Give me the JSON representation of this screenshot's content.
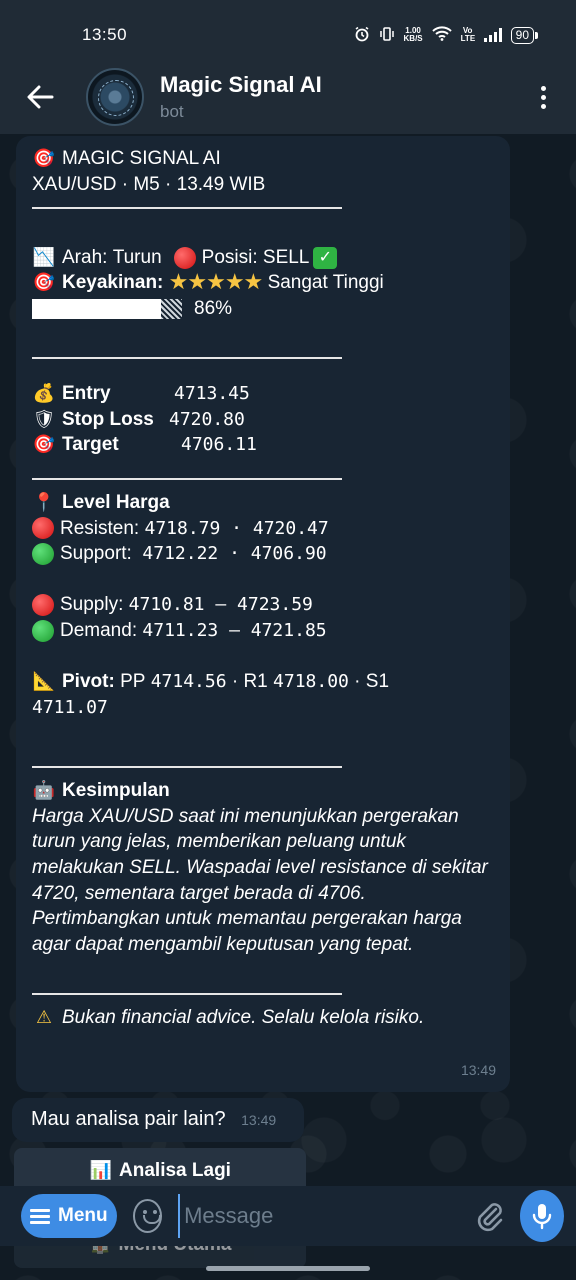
{
  "status_bar": {
    "time": "13:50",
    "speed_value": "1.00",
    "speed_unit": "KB/S",
    "volte": "Vo LTE",
    "battery": "90"
  },
  "app_bar": {
    "title": "Magic Signal AI",
    "subtitle": "bot"
  },
  "signal_message": {
    "header_title": "MAGIC SIGNAL AI",
    "header_info": "XAU/USD · M5 · 13.49 WIB",
    "direction_label": "Arah:",
    "direction_value": "Turun",
    "position_label": "Posisi:",
    "position_value": "SELL",
    "confidence_label": "Keyakinan:",
    "confidence_stars": "★★★★★",
    "confidence_text": "Sangat Tinggi",
    "confidence_percent_label": "86%",
    "confidence_percent": 86,
    "entry_label": "Entry",
    "entry_value": "4713.45",
    "stoploss_label": "Stop Loss",
    "stoploss_value": "4720.80",
    "target_label": "Target",
    "target_value": "4706.11",
    "level_title": "Level Harga",
    "resisten_label": "Resisten:",
    "resisten_values": "4718.79 · 4720.47",
    "support_label": "Support:",
    "support_values": "4712.22 · 4706.90",
    "supply_label": "Supply:",
    "supply_values": "4710.81 — 4723.59",
    "demand_label": "Demand:",
    "demand_values": "4711.23 — 4721.85",
    "pivot_label": "Pivot:",
    "pivot_pp_label": "PP",
    "pivot_pp": "4714.56",
    "pivot_r1_label": "R1",
    "pivot_r1": "4718.00",
    "pivot_s1_label": "S1",
    "pivot_s1": "4711.07",
    "conclusion_title": "Kesimpulan",
    "conclusion_text": "Harga XAU/USD saat ini menunjukkan pergerakan turun yang jelas, memberikan peluang untuk melakukan SELL. Waspadai level resistance di sekitar 4720, sementara target berada di 4706. Pertimbangkan untuk memantau pergerakan harga agar dapat mengambil keputusan yang tepat.",
    "disclaimer": "Bukan financial advice. Selalu kelola risiko.",
    "time": "13:49"
  },
  "followup_message": {
    "text": "Mau analisa pair lain?",
    "time": "13:49"
  },
  "keyboard": {
    "button_1": "Analisa Lagi",
    "button_2": "Menu Utama"
  },
  "input_bar": {
    "menu_label": "Menu",
    "placeholder": "Message"
  },
  "colors": {
    "accent": "#3e8ce4",
    "bubble": "#182533",
    "header": "#202b36",
    "background": "#0e1621"
  }
}
